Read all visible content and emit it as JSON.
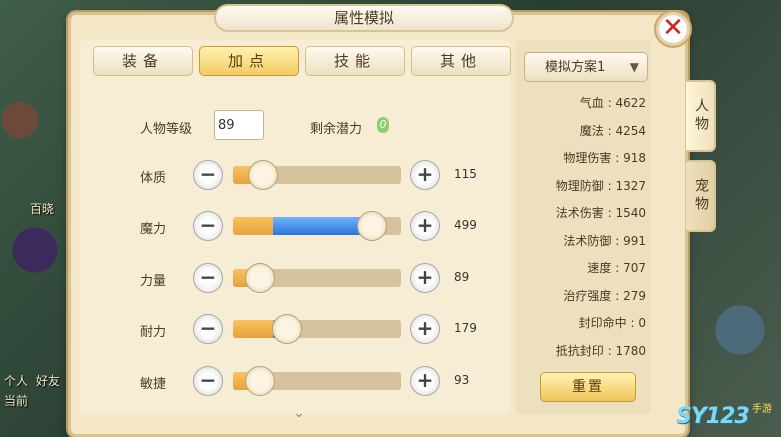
{
  "title": "属性模拟",
  "tabs": [
    {
      "label": "装备",
      "active": false
    },
    {
      "label": "加点",
      "active": true
    },
    {
      "label": "技能",
      "active": false
    },
    {
      "label": "其他",
      "active": false
    }
  ],
  "level": {
    "label": "人物等级",
    "value": "89"
  },
  "potential": {
    "label": "剩余潜力",
    "value": "0"
  },
  "attributes": [
    {
      "label": "体质",
      "value": "115",
      "minus": "−",
      "plus": "+",
      "fill": 0.18,
      "blue_fill": 0
    },
    {
      "label": "魔力",
      "value": "499",
      "minus": "−",
      "plus": "+",
      "fill": 0.83,
      "blue_fill": 0.58
    },
    {
      "label": "力量",
      "value": "89",
      "minus": "−",
      "plus": "+",
      "fill": 0.16,
      "blue_fill": 0
    },
    {
      "label": "耐力",
      "value": "179",
      "minus": "−",
      "plus": "+",
      "fill": 0.32,
      "blue_fill": 0.07
    },
    {
      "label": "敏捷",
      "value": "93",
      "minus": "−",
      "plus": "+",
      "fill": 0.16,
      "blue_fill": 0
    }
  ],
  "plan": {
    "label": "模拟方案1"
  },
  "stats": [
    {
      "label": "气血",
      "value": "4622"
    },
    {
      "label": "魔法",
      "value": "4254"
    },
    {
      "label": "物理伤害",
      "value": "918"
    },
    {
      "label": "物理防御",
      "value": "1327"
    },
    {
      "label": "法术伤害",
      "value": "1540"
    },
    {
      "label": "法术防御",
      "value": "991"
    },
    {
      "label": "速度",
      "value": "707"
    },
    {
      "label": "治疗强度",
      "value": "279"
    },
    {
      "label": "封印命中",
      "value": "0"
    },
    {
      "label": "抵抗封印",
      "value": "1780"
    }
  ],
  "reset_label": "重置",
  "side_tabs": [
    {
      "label": "人物",
      "active": true
    },
    {
      "label": "宠物",
      "active": false
    }
  ],
  "close_label": "✕",
  "scroll_chevron": "⌄",
  "background_text": [
    "百晓",
    "个人",
    "好友",
    "当前"
  ],
  "watermark": {
    "main": "SY123",
    "sub": "手游"
  },
  "colors": {
    "accent": "#f3cc62",
    "blue_bar": "#2c73d8",
    "orange_bar": "#e8a23a",
    "close": "#d21f1f"
  }
}
